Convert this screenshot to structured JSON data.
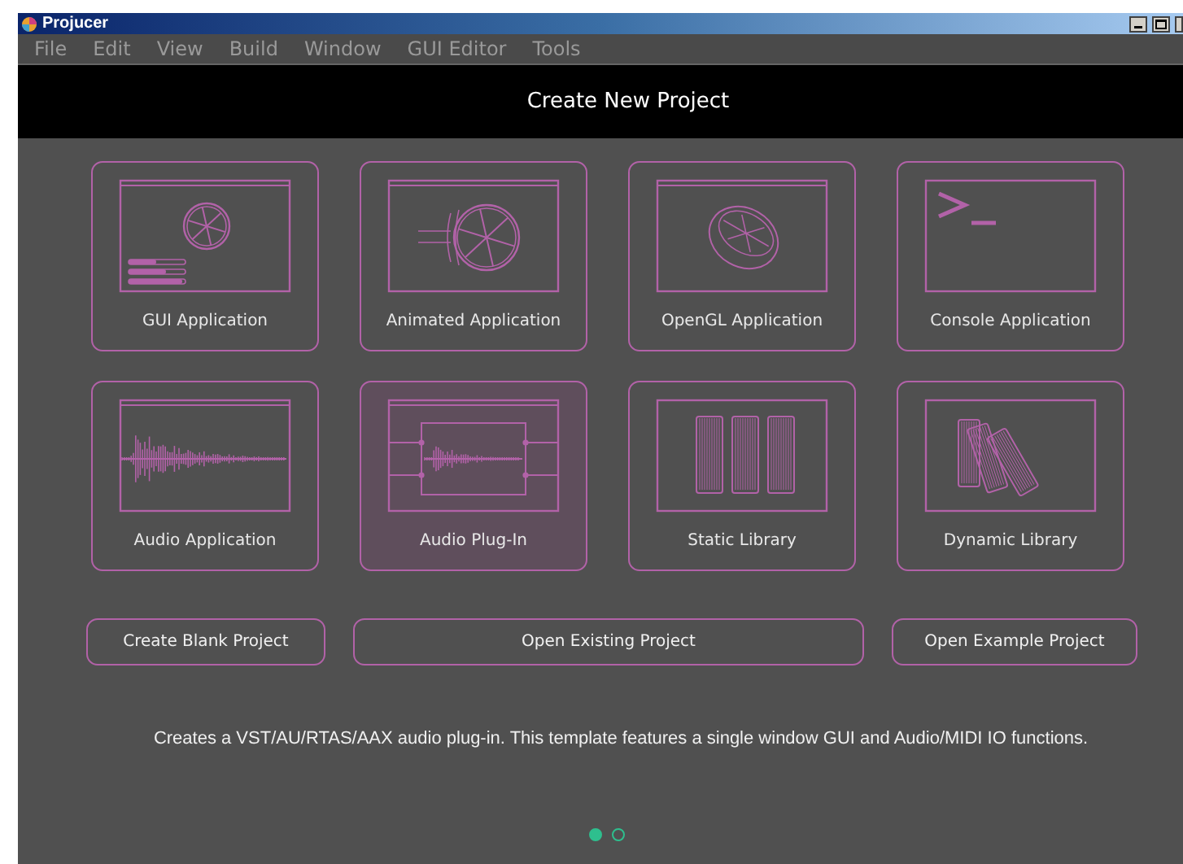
{
  "window": {
    "title": "Projucer"
  },
  "menu": [
    "File",
    "Edit",
    "View",
    "Build",
    "Window",
    "GUI Editor",
    "Tools"
  ],
  "header": {
    "title": "Create New Project"
  },
  "templates": [
    {
      "label": "GUI Application",
      "kind": "gui",
      "selected": false
    },
    {
      "label": "Animated Application",
      "kind": "animated",
      "selected": false
    },
    {
      "label": "OpenGL Application",
      "kind": "opengl",
      "selected": false
    },
    {
      "label": "Console Application",
      "kind": "console",
      "selected": false
    },
    {
      "label": "Audio Application",
      "kind": "audio",
      "selected": false
    },
    {
      "label": "Audio Plug-In",
      "kind": "plugin",
      "selected": true
    },
    {
      "label": "Static Library",
      "kind": "static",
      "selected": false
    },
    {
      "label": "Dynamic Library",
      "kind": "dynamic",
      "selected": false
    }
  ],
  "buttons": [
    "Create Blank Project",
    "Open Existing Project",
    "Open Example Project"
  ],
  "description": "Creates a VST/AU/RTAS/AAX audio plug-in. This template features a single window GUI and Audio/MIDI IO functions.",
  "pages": [
    {
      "selected": true
    },
    {
      "selected": false
    }
  ]
}
